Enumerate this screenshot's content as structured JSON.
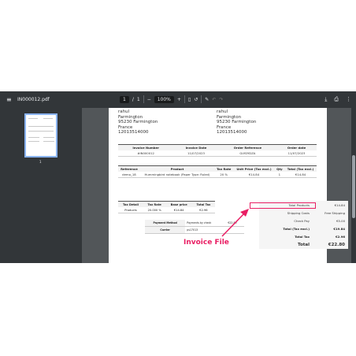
{
  "toolbar": {
    "menu_icon": "menu-icon",
    "title": "IN000012.pdf",
    "page_current": "1",
    "page_sep": "/",
    "page_total": "1",
    "zoom_out": "−",
    "zoom": "100%",
    "zoom_in": "+",
    "right_icons": [
      "download-icon",
      "print-icon",
      "more-icon"
    ]
  },
  "sidebar": {
    "thumb_label": "1"
  },
  "invoice": {
    "addr_left": [
      "rahul",
      "Farmington",
      "95230 Farmington",
      "France",
      "12013514000"
    ],
    "addr_right": [
      "rahul",
      "Farmington",
      "95230 Farmington",
      "France",
      "12013514000"
    ],
    "header_cols": [
      "Invoice Number",
      "Invoice Date",
      "Order Reference",
      "Order date"
    ],
    "header_vals": [
      "#IN000012",
      "11/07/2023",
      "GLYDYDZA",
      "11/07/2023"
    ],
    "item_cols": [
      "Reference",
      "Product",
      "Tax Rate",
      "Unit Price (Tax excl.)",
      "Qty",
      "Total (Tax excl.)"
    ],
    "item_row": [
      "demo_18",
      "Hummingbird notebook (Paper Type: Ruled)",
      "20 %",
      "€14.84",
      "1",
      "€14.84"
    ],
    "tax_cols": [
      "Tax Detail",
      "Tax Rate",
      "Base price",
      "Total Tax"
    ],
    "tax_row": [
      "Products",
      "20.000 %",
      "€14.84",
      "€2.96"
    ],
    "pay_cols": [
      "Payment Method",
      "Payments by check",
      "€22.80"
    ],
    "carrier_row": [
      "Carrier",
      "ps17013"
    ],
    "totals": [
      {
        "label": "Total Products",
        "value": "€14.84"
      },
      {
        "label": "Shipping Costs",
        "value": "Free Shipping"
      },
      {
        "label": "Check Pay",
        "value": "€5.00"
      },
      {
        "label": "Total (Tax excl.)",
        "value": "€19.84"
      },
      {
        "label": "Total Tax",
        "value": "€2.96"
      },
      {
        "label": "Total",
        "value": "€22.80"
      }
    ]
  },
  "annotation": {
    "callout": "Invoice File",
    "color": "#e91e63"
  }
}
